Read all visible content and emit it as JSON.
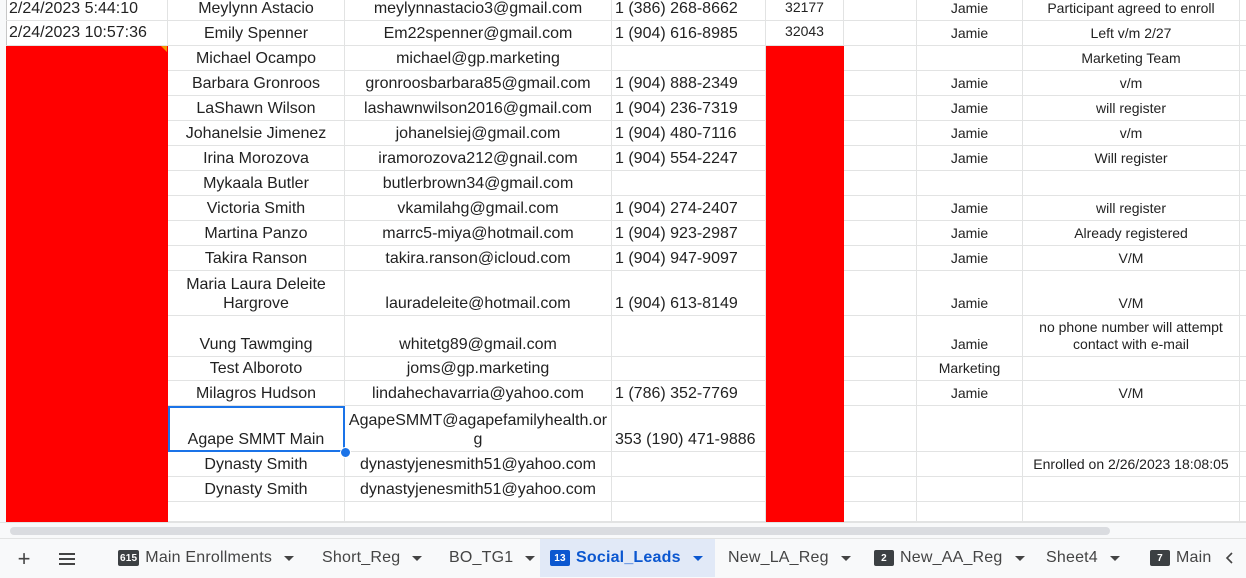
{
  "colors": {
    "highlight": "#ff0000",
    "selection": "#1a73e8",
    "active_tab_bg": "#e1e9f7",
    "active_tab_text": "#0b57d0"
  },
  "rows": [
    {
      "timestamp": "2/24/2023 5:44:10",
      "name": "Meylynn Astacio",
      "email": "meylynnastacio3@gmail.com",
      "phone": "1 (386) 268-8662",
      "code": "32177",
      "agent": "Jamie",
      "notes": "Participant agreed to enroll"
    },
    {
      "timestamp": "2/24/2023 10:57:36",
      "name": "Emily Spenner",
      "email": "Em22spenner@gmail.com",
      "phone": "1 (904) 616-8985",
      "code": "32043",
      "agent": "Jamie",
      "notes": "Left v/m 2/27"
    },
    {
      "timestamp": "",
      "name": "Michael Ocampo",
      "email": "michael@gp.marketing",
      "phone": "",
      "code": "",
      "agent": "",
      "notes": "Marketing Team"
    },
    {
      "timestamp": "",
      "name": "Barbara Gronroos",
      "email": "gronroosbarbara85@gmail.com",
      "phone": "1 (904) 888-2349",
      "code": "",
      "agent": "Jamie",
      "notes": "v/m"
    },
    {
      "timestamp": "",
      "name": "LaShawn Wilson",
      "email": "lashawnwilson2016@gmail.com",
      "phone": "1 (904) 236-7319",
      "code": "",
      "agent": "Jamie",
      "notes": "will register"
    },
    {
      "timestamp": "",
      "name": "Johanelsie Jimenez",
      "email": "johanelsiej@gmail.com",
      "phone": "1 (904) 480-7116",
      "code": "",
      "agent": "Jamie",
      "notes": "v/m"
    },
    {
      "timestamp": "",
      "name": "Irina Morozova",
      "email": "iramorozova212@gnail.com",
      "phone": "1 (904) 554-2247",
      "code": "",
      "agent": "Jamie",
      "notes": "Will register"
    },
    {
      "timestamp": "",
      "name": "Mykaala Butler",
      "email": "butlerbrown34@gmail.com",
      "phone": "",
      "code": "",
      "agent": "",
      "notes": ""
    },
    {
      "timestamp": "",
      "name": "Victoria Smith",
      "email": "vkamilahg@gmail.com",
      "phone": "1 (904) 274-2407",
      "code": "",
      "agent": "Jamie",
      "notes": "will register"
    },
    {
      "timestamp": "",
      "name": "Martina Panzo",
      "email": "marrc5-miya@hotmail.com",
      "phone": "1 (904) 923-2987",
      "code": "",
      "agent": "Jamie",
      "notes": "Already registered"
    },
    {
      "timestamp": "",
      "name": "Takira Ranson",
      "email": "takira.ranson@icloud.com",
      "phone": "1 (904) 947-9097",
      "code": "",
      "agent": "Jamie",
      "notes": "V/M"
    },
    {
      "timestamp": "",
      "name": "Maria Laura Deleite Hargrove",
      "email": "lauradeleite@hotmail.com",
      "phone": "1 (904) 613-8149",
      "code": "",
      "agent": "Jamie",
      "notes": "V/M"
    },
    {
      "timestamp": "",
      "name": "Vung Tawmging",
      "email": "whitetg89@gmail.com",
      "phone": "",
      "code": "",
      "agent": "Jamie",
      "notes": "no phone number will attempt contact with e-mail"
    },
    {
      "timestamp": "",
      "name": "Test Alboroto",
      "email": "joms@gp.marketing",
      "phone": "",
      "code": "",
      "agent": "Marketing",
      "notes": ""
    },
    {
      "timestamp": "",
      "name": "Milagros Hudson",
      "email": "lindahechavarria@yahoo.com",
      "phone": "1 (786) 352-7769",
      "code": "",
      "agent": "Jamie",
      "notes": "V/M"
    },
    {
      "timestamp": "",
      "name": "Agape SMMT Main",
      "email": "AgapeSMMT@agapefamilyhealth.org",
      "phone": "353 (190) 471-9886",
      "code": "",
      "agent": "",
      "notes": ""
    },
    {
      "timestamp": "",
      "name": "Dynasty Smith",
      "email": "dynastyjenesmith51@yahoo.com",
      "phone": "",
      "code": "",
      "agent": "",
      "notes": "Enrolled on 2/26/2023 18:08:05"
    },
    {
      "timestamp": "",
      "name": "Dynasty Smith",
      "email": "dynastyjenesmith51@yahoo.com",
      "phone": "",
      "code": "",
      "agent": "",
      "notes": ""
    },
    {
      "timestamp": "",
      "name": "",
      "email": "",
      "phone": "",
      "code": "",
      "agent": "",
      "notes": ""
    }
  ],
  "tabs": [
    {
      "label": "Main Enrollments",
      "badge": "615"
    },
    {
      "label": "Short_Reg",
      "badge": ""
    },
    {
      "label": "BO_TG1",
      "badge": ""
    },
    {
      "label": "Social_Leads",
      "badge": "13"
    },
    {
      "label": "New_LA_Reg",
      "badge": ""
    },
    {
      "label": "New_AA_Reg",
      "badge": "2"
    },
    {
      "label": "Sheet4",
      "badge": ""
    },
    {
      "label": "Main",
      "badge": "7"
    }
  ],
  "active_tab": "Social_Leads",
  "icons": {
    "add": "plus-icon",
    "all_sheets": "menu-icon",
    "scroll": "chevron-left-icon"
  }
}
